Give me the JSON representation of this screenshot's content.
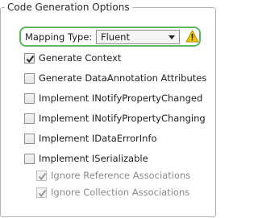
{
  "group": {
    "title": "Code Generation Options"
  },
  "mapping": {
    "label": "Mapping Type:",
    "selected": "Fluent",
    "warning_icon": "warning-icon",
    "highlight_color": "#5cb85c",
    "warning_color": "#f2c200"
  },
  "options": [
    {
      "label": "Generate Context",
      "checked": true,
      "enabled": true
    },
    {
      "label": "Generate DataAnnotation Attributes",
      "checked": false,
      "enabled": true
    },
    {
      "label": "Implement INotifyPropertyChanged",
      "checked": false,
      "enabled": true
    },
    {
      "label": "Implement INotifyPropertyChanging",
      "checked": false,
      "enabled": true
    },
    {
      "label": "Implement IDataErrorInfo",
      "checked": false,
      "enabled": true
    },
    {
      "label": "Implement ISerializable",
      "checked": false,
      "enabled": true
    },
    {
      "label": "Ignore Reference Associations",
      "checked": true,
      "enabled": false
    },
    {
      "label": "Ignore Collection Associations",
      "checked": true,
      "enabled": false
    }
  ]
}
